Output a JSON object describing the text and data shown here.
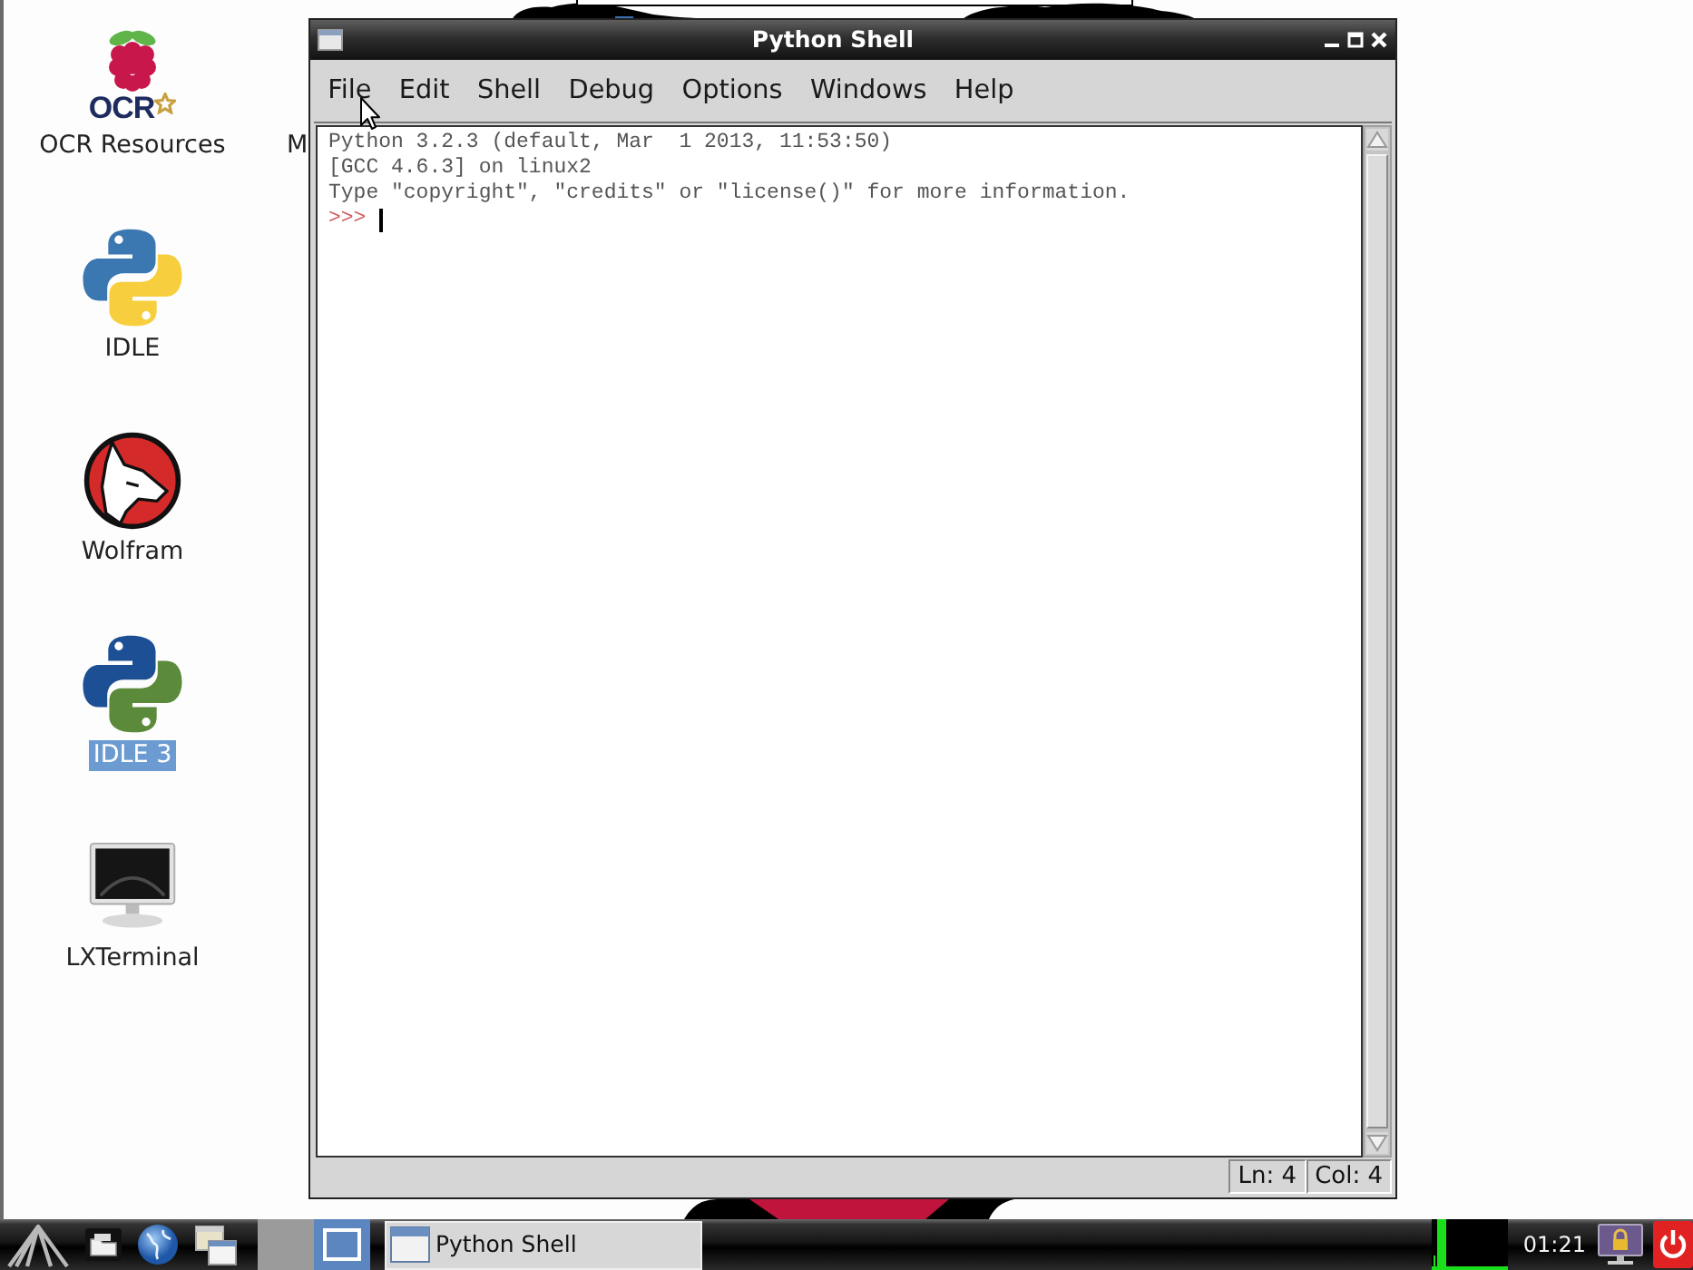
{
  "desktop": {
    "icons": [
      {
        "kind": "ocr",
        "logo_text": "OCR",
        "label": "OCR Resources",
        "selected": false
      },
      {
        "kind": "python",
        "label": "IDLE",
        "selected": false
      },
      {
        "kind": "wolfram",
        "label": "Wolfram",
        "selected": false
      },
      {
        "kind": "python3",
        "label": "IDLE 3",
        "selected": true
      },
      {
        "kind": "terminal",
        "label": "LXTerminal",
        "selected": false
      }
    ],
    "partial_label": "M"
  },
  "window": {
    "title": "Python Shell",
    "menu": [
      "File",
      "Edit",
      "Shell",
      "Debug",
      "Options",
      "Windows",
      "Help"
    ],
    "shell": {
      "lines": [
        "Python 3.2.3 (default, Mar  1 2013, 11:53:50)",
        "[GCC 4.6.3] on linux2",
        "Type \"copyright\", \"credits\" or \"license()\" for more information."
      ],
      "prompt": ">>>"
    },
    "status": [
      "Ln: 4",
      "Col: 4"
    ]
  },
  "taskbar": {
    "launchers": [
      {
        "kind": "menu"
      },
      {
        "kind": "files"
      },
      {
        "kind": "browser"
      },
      {
        "kind": "desktop"
      }
    ],
    "pager": [
      {
        "selected": false
      },
      {
        "selected": true
      }
    ],
    "tasks": [
      {
        "title": "Python Shell"
      }
    ],
    "clock": "01:21",
    "tray": [
      {
        "kind": "lock"
      },
      {
        "kind": "power"
      }
    ]
  }
}
